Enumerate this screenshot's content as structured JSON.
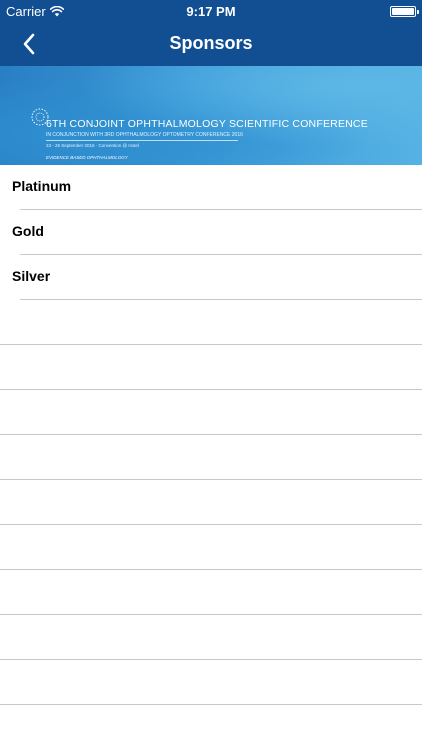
{
  "status_bar": {
    "carrier": "Carrier",
    "time": "9:17 PM",
    "icons": [
      "wifi-icon",
      "battery-icon"
    ]
  },
  "nav": {
    "title": "Sponsors",
    "back_icon": "chevron-left-icon"
  },
  "banner": {
    "title": "6TH CONJOINT OPHTHALMOLOGY SCIENTIFIC CONFERENCE",
    "subtitle": "IN CONJUNCTION WITH 3RD OPHTHALMOLOGY OPTOMETRY CONFERENCE 2016",
    "date": "23 - 25 September 2016 · Convention @ Hotel",
    "tagline": "EVIDENCE BASED OPHTHALMOLOGY"
  },
  "sponsor_tiers": [
    {
      "label": "Platinum"
    },
    {
      "label": "Gold"
    },
    {
      "label": "Silver"
    }
  ],
  "colors": {
    "nav_background": "#114f92",
    "separator": "#c8c7cc"
  }
}
